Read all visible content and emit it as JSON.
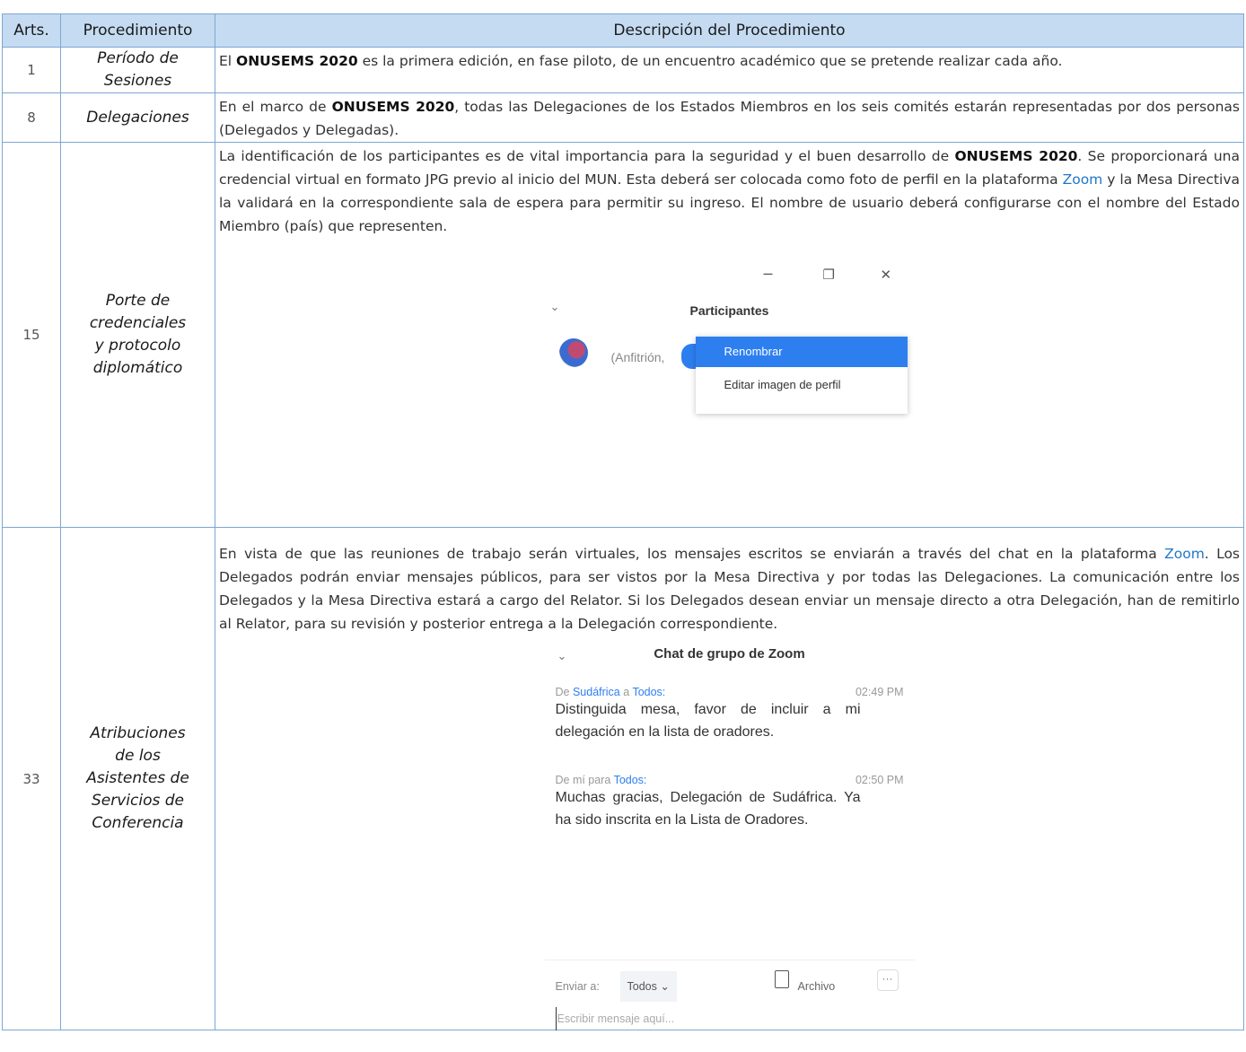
{
  "table": {
    "headers": [
      "Arts.",
      "Procedimiento",
      "Descripción del Procedimiento"
    ],
    "rows": [
      {
        "art": "1",
        "name": "Período de Sesiones",
        "pre": "El ",
        "bold1": "ONUSEMS 2020",
        "post": " es la primera edición, en fase piloto, de un encuentro académico que se pretende realizar cada año."
      },
      {
        "art": "8",
        "name": "Delegaciones",
        "pre": "En el marco de ",
        "bold1": "ONUSEMS 2020",
        "post": ", todas las Delegaciones de los Estados Miembros en los seis comités estarán representadas por dos personas (Delegados y Delegadas)."
      },
      {
        "art": "15",
        "name_lines": [
          "Porte de",
          "credenciales",
          "y protocolo",
          "diplomático"
        ],
        "pre": "La identificación de los participantes es de vital importancia para la seguridad y el buen desarrollo de ",
        "bold1": "ONUSEMS 2020",
        "mid": ". Se proporcionará una credencial virtual en formato JPG previo al inicio del MUN. Esta deberá ser colocada como foto de perfil en la plataforma ",
        "link": "Zoom",
        "post": " y la Mesa Directiva la validará en la correspondiente sala de espera para permitir su ingreso. El nombre de usuario deberá configurarse con el nombre del Estado Miembro (país) que representen."
      },
      {
        "art": "33",
        "name_lines": [
          "Atribuciones",
          "de los",
          "Asistentes de",
          "Servicios de",
          "Conferencia"
        ],
        "pre": "En vista de que las reuniones de trabajo serán virtuales, los mensajes escritos se enviarán a través del chat en la plataforma ",
        "link": "Zoom",
        "post": ". Los Delegados podrán enviar mensajes públicos, para ser vistos por la Mesa Directiva y por todas las Delegaciones. La comunicación entre los Delegados y la Mesa Directiva estará a cargo del Relator. Si los Delegados desean enviar un mensaje directo a otra Delegación, han de remitirlo al Relator, para su revisión y posterior entrega a la Delegación correspondiente."
      }
    ]
  },
  "participants_panel": {
    "title": "Participantes",
    "host_label": "(Anfitrión,",
    "menu_selected": "Renombrar",
    "menu_option": "Editar imagen de perfil",
    "minimize": "–",
    "restore": "❐",
    "close": "✕"
  },
  "chat_panel": {
    "title": "Chat de grupo de Zoom",
    "messages": [
      {
        "pre": "De ",
        "from": "Sudáfrica",
        "mid": " a ",
        "to": "Todos:",
        "time": "02:49 PM",
        "text": "Distinguida mesa, favor de incluir a mi delegación en la lista de oradores."
      },
      {
        "pre": "De mí para ",
        "from": "",
        "mid": "",
        "to": "Todos:",
        "time": "02:50 PM",
        "text": "Muchas gracias, Delegación de Sudáfrica.  Ya ha sido inscrita en la Lista de Oradores."
      }
    ],
    "send_to_label": "Enviar a:",
    "send_to_value": "Todos",
    "file_label": "Archivo",
    "more": "···",
    "input_placeholder": "Escribir mensaje aquí..."
  },
  "colors": {
    "header_bg": "#c5dbf1",
    "border": "#7ea6d3",
    "link": "#1f77c8",
    "zoom_blue": "#2d7ff0"
  }
}
